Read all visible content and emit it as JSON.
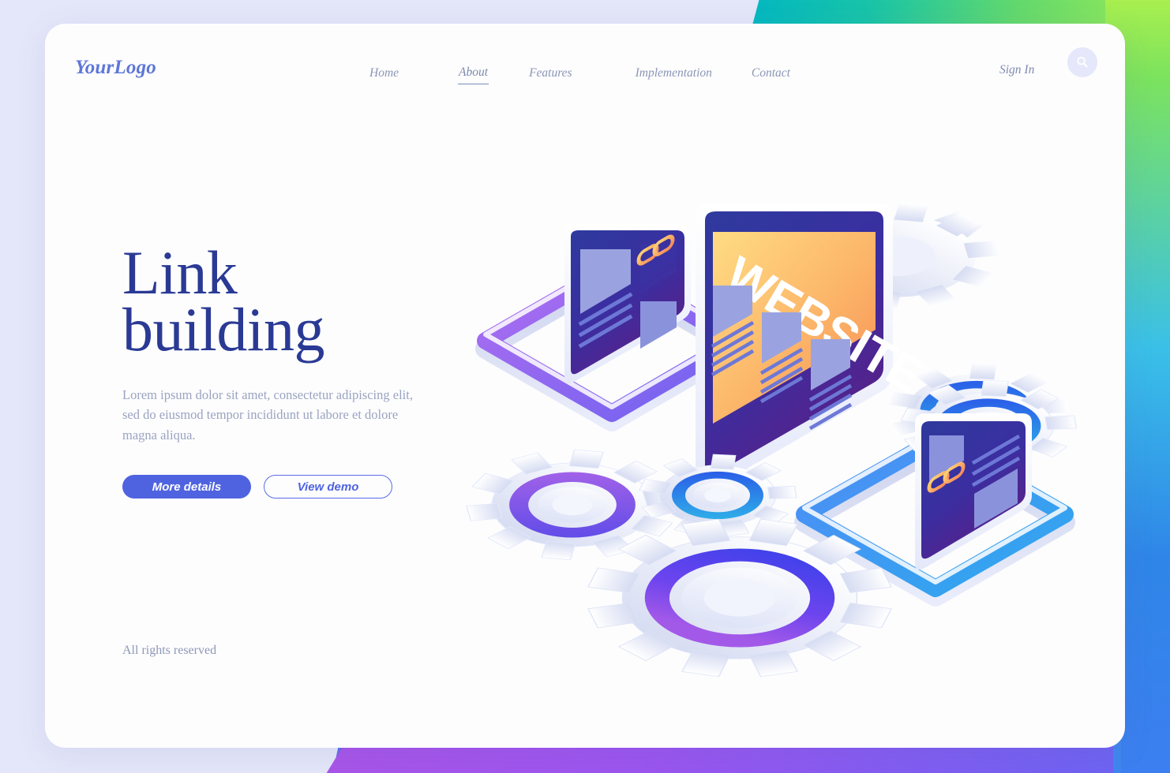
{
  "brand": {
    "logo": "YourLogo",
    "accent": "#4f63e0",
    "headline_color": "#2a3a94",
    "logo_color": "#5d77d8"
  },
  "header": {
    "nav": [
      {
        "label": "Home",
        "active": false
      },
      {
        "label": "About",
        "active": true
      },
      {
        "label": "Features",
        "active": false
      },
      {
        "label": "Implementation",
        "active": false
      },
      {
        "label": "Contact",
        "active": false
      }
    ],
    "sign_in": "Sign In",
    "search_icon": "search-icon"
  },
  "hero": {
    "title_line1": "Link",
    "title_line2": "building",
    "subtitle": "Lorem ipsum dolor sit amet, consectetur adipiscing elit, sed do eiusmod tempor incididunt ut labore et dolore magna aliqua.",
    "primary_button": "More details",
    "secondary_button": "View demo"
  },
  "footer": {
    "rights": "All rights reserved"
  },
  "illustration": {
    "screen_banner_text": "WEBSITE",
    "left_screen_icon": "chain-link-icon",
    "right_screen_icon": "chain-link-icon",
    "gears": [
      "gear-purple",
      "gear-blue",
      "gear-violet",
      "gear-white-top",
      "gear-white-right"
    ],
    "platform_left_color": "#9b5de8",
    "platform_right_color": "#3c8ef0",
    "banner_gradient_start": "#ffd77a",
    "banner_gradient_end": "#f58b52"
  },
  "background": {
    "page_color": "#e4e6f9",
    "top_right_gradient": [
      "#00b6c4",
      "#a3ee52"
    ],
    "bottom_left_gradient": [
      "#a855e8",
      "#6e63f2"
    ],
    "bottom_right_gradient": [
      "#7a6df2",
      "#3f86ee"
    ]
  }
}
